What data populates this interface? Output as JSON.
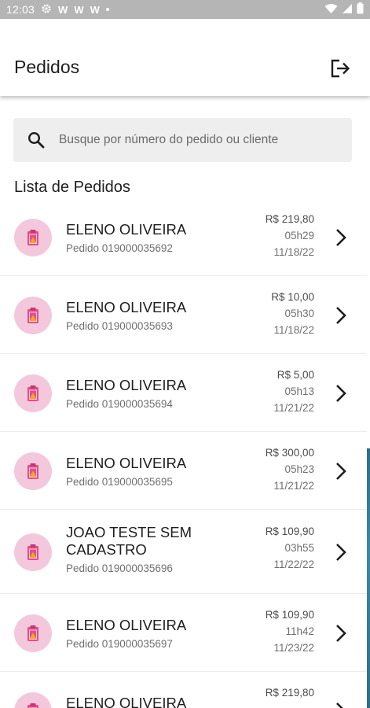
{
  "status_bar": {
    "time": "12:03",
    "left_icons": [
      "gear-icon",
      "w-notification-icon",
      "w-notification-icon",
      "w-notification-icon",
      "dot-icon"
    ],
    "right_icons": [
      "wifi-icon",
      "signal-icon",
      "battery-icon"
    ],
    "background": "#b5b5b5"
  },
  "header": {
    "title": "Pedidos",
    "logout_icon": "logout-icon"
  },
  "search": {
    "placeholder": "Busque por número do pedido ou cliente"
  },
  "list": {
    "title": "Lista de Pedidos",
    "orders": [
      {
        "client": "ELENO OLIVEIRA",
        "order": "Pedido 019000035692",
        "price": "R$ 219,80",
        "time": "05h29",
        "date": "11/18/22"
      },
      {
        "client": "ELENO OLIVEIRA",
        "order": "Pedido 019000035693",
        "price": "R$ 10,00",
        "time": "05h30",
        "date": "11/18/22"
      },
      {
        "client": "ELENO OLIVEIRA",
        "order": "Pedido 019000035694",
        "price": "R$ 5,00",
        "time": "05h13",
        "date": "11/21/22"
      },
      {
        "client": "ELENO OLIVEIRA",
        "order": "Pedido 019000035695",
        "price": "R$ 300,00",
        "time": "05h23",
        "date": "11/21/22"
      },
      {
        "client": "JOAO TESTE SEM CADASTRO",
        "order": "Pedido 019000035696",
        "price": "R$ 109,90",
        "time": "03h55",
        "date": "11/22/22"
      },
      {
        "client": "ELENO OLIVEIRA",
        "order": "Pedido 019000035697",
        "price": "R$ 109,90",
        "time": "11h42",
        "date": "11/23/22"
      },
      {
        "client": "ELENO OLIVEIRA",
        "order": "",
        "price": "R$ 219,80",
        "time": "",
        "date": ""
      }
    ]
  },
  "colors": {
    "avatar_bg": "#f3c8dc",
    "avatar_icon": "#e84d8a",
    "avatar_accent": "#f5a623",
    "search_bg": "#eeeeee"
  }
}
